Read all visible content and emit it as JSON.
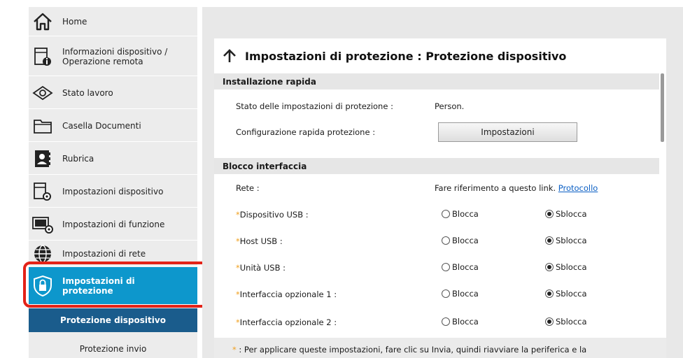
{
  "sidebar": {
    "items": [
      {
        "label": "Home",
        "icon": "home-icon"
      },
      {
        "label": "Informazioni dispositivo / Operazione remota",
        "icon": "device-info-icon"
      },
      {
        "label": "Stato lavoro",
        "icon": "eye-icon"
      },
      {
        "label": "Casella Documenti",
        "icon": "folder-icon"
      },
      {
        "label": "Rubrica",
        "icon": "address-book-icon"
      },
      {
        "label": "Impostazioni dispositivo",
        "icon": "device-settings-icon"
      },
      {
        "label": "Impostazioni di funzione",
        "icon": "function-settings-icon"
      },
      {
        "label": "Impostazioni di rete",
        "icon": "globe-icon"
      },
      {
        "label": "Impostazioni di protezione",
        "icon": "shield-lock-icon"
      }
    ],
    "sub_items": [
      {
        "label": "Protezione dispositivo"
      },
      {
        "label": "Protezione invio"
      }
    ]
  },
  "page": {
    "title": "Impostazioni di protezione : Protezione dispositivo"
  },
  "quick_setup": {
    "heading": "Installazione rapida",
    "status_label": "Stato delle impostazioni di protezione :",
    "status_value": "Person.",
    "config_label": "Configurazione rapida protezione :",
    "button_label": "Impostazioni"
  },
  "interface_block": {
    "heading": "Blocco interfaccia",
    "network_label": "Rete :",
    "network_text": "Fare riferimento a questo link.",
    "network_link": "Protocollo",
    "lock_label": "Blocca",
    "unlock_label": "Sblocca",
    "rows": [
      {
        "label": "Dispositivo USB :",
        "selected": "Sblocca"
      },
      {
        "label": "Host USB :",
        "selected": "Sblocca"
      },
      {
        "label": "Unità USB :",
        "selected": "Sblocca"
      },
      {
        "label": "Interfaccia opzionale 1 :",
        "selected": "Sblocca"
      },
      {
        "label": "Interfaccia opzionale 2 :",
        "selected": "Sblocca"
      }
    ]
  },
  "footnote": {
    "star": "*",
    "text": ":  Per applicare queste impostazioni, fare clic su Invia, quindi riavviare la periferica e la"
  },
  "colors": {
    "active_item": "#0d97cc",
    "active_sub": "#1a5c8c",
    "highlight_border": "#e32217",
    "required_star": "#f0a020",
    "link": "#0b5fc4"
  }
}
